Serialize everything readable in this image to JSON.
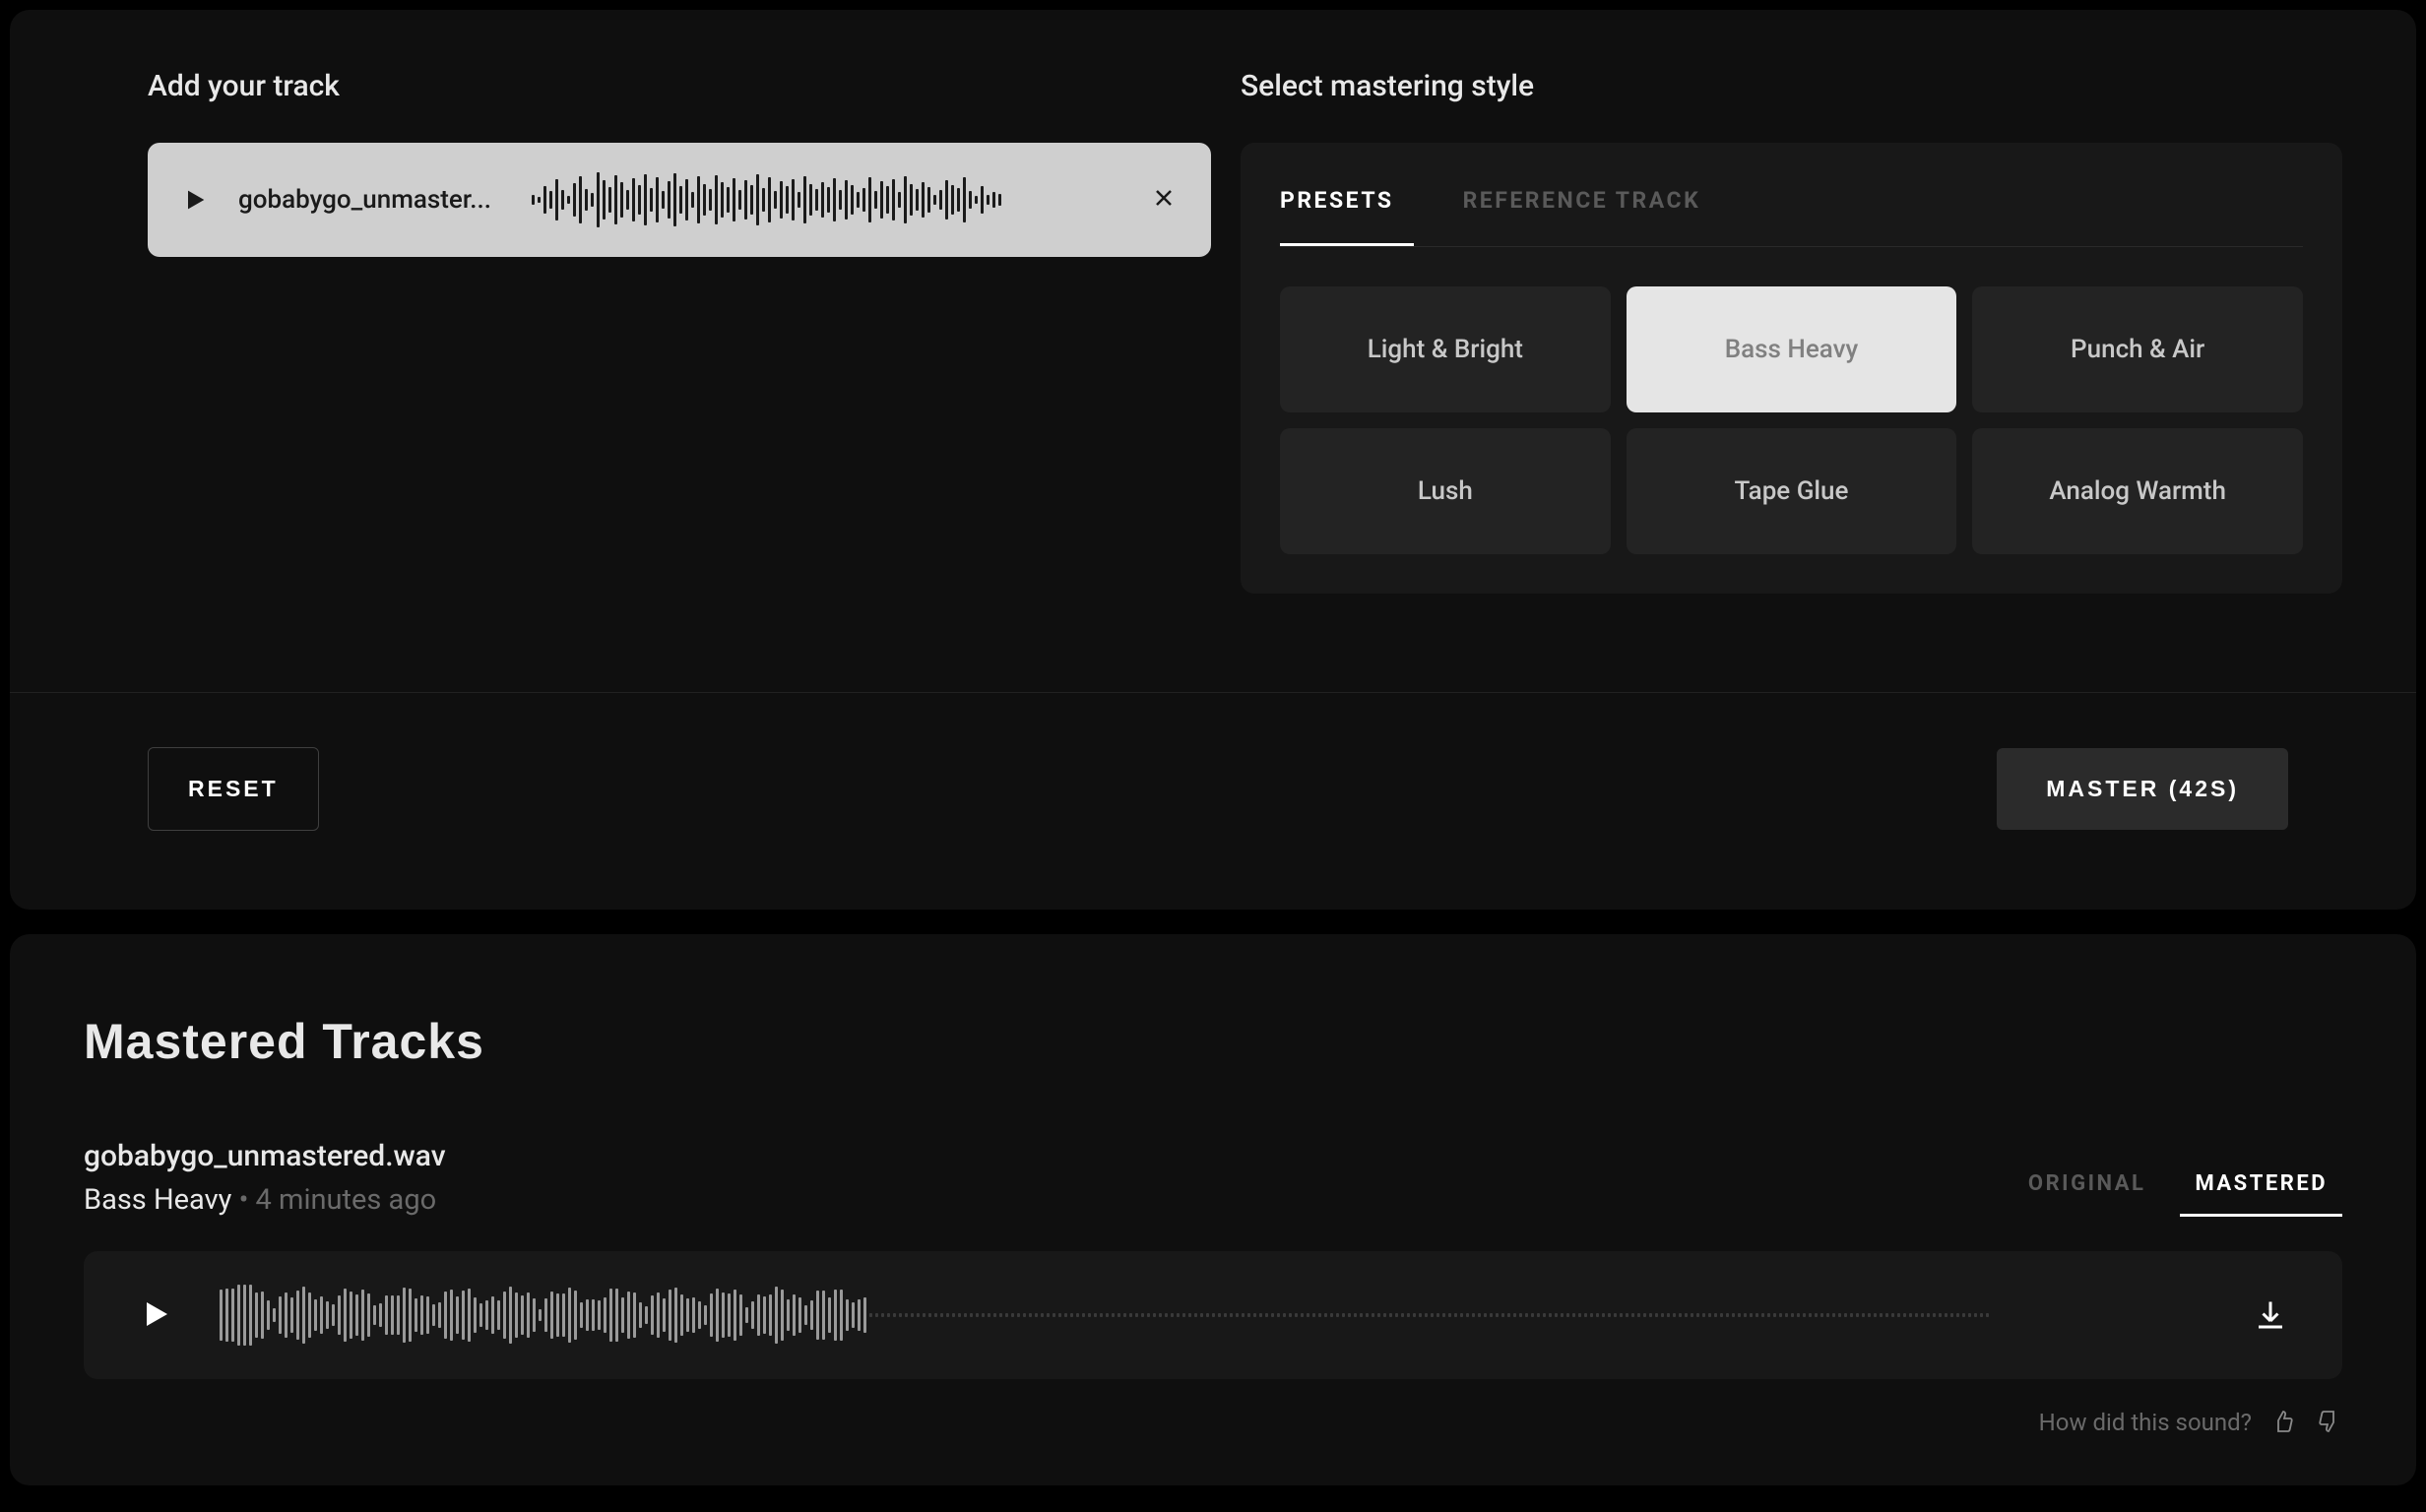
{
  "upload": {
    "heading": "Add your track",
    "filename": "gobabygo_unmaster..."
  },
  "styleSelect": {
    "heading": "Select mastering style",
    "tabs": {
      "presets": "PRESETS",
      "reference": "REFERENCE TRACK"
    },
    "presets": [
      "Light & Bright",
      "Bass Heavy",
      "Punch & Air",
      "Lush",
      "Tape Glue",
      "Analog Warmth"
    ],
    "selectedPreset": "Bass Heavy"
  },
  "actions": {
    "reset": "RESET",
    "master": "MASTER (42S)"
  },
  "results": {
    "sectionTitle": "Mastered Tracks",
    "filename": "gobabygo_unmastered.wav",
    "preset": "Bass Heavy",
    "separator": " • ",
    "timestamp": "4 minutes ago",
    "versionTabs": {
      "original": "ORIGINAL",
      "mastered": "MASTERED"
    },
    "feedbackPrompt": "How did this sound?"
  }
}
